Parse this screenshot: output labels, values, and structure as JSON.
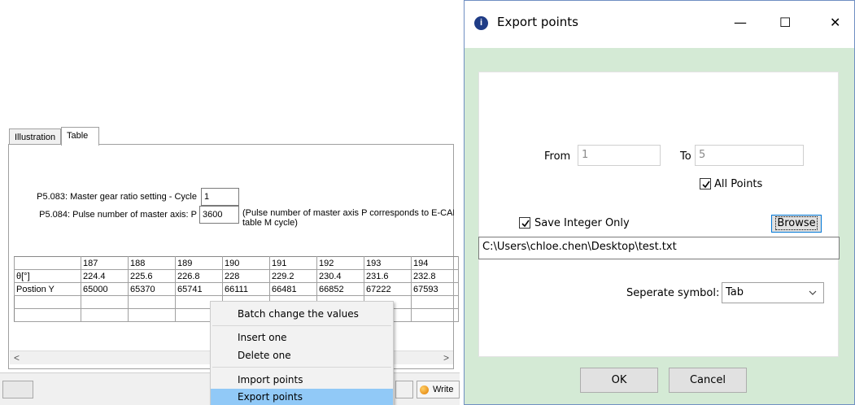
{
  "left": {
    "tabs": [
      {
        "label": "Illustration"
      },
      {
        "label": "Table"
      }
    ],
    "params": [
      {
        "label": "P5.083: Master gear ratio setting - Cycle",
        "value": "1"
      },
      {
        "label": "P5.084: Pulse number of master axis: P",
        "value": "3600",
        "note_line1": "(Pulse number of master axis P corresponds to E-CAM",
        "note_line2": "table M cycle)"
      }
    ],
    "table": {
      "columns": [
        "187",
        "188",
        "189",
        "190",
        "191",
        "192",
        "193",
        "194"
      ],
      "rows": [
        {
          "header": "θ[°]",
          "values": [
            "224.4",
            "225.6",
            "226.8",
            "228",
            "229.2",
            "230.4",
            "231.6",
            "232.8"
          ]
        },
        {
          "header": "Postion Y",
          "values": [
            "65000",
            "65370",
            "65741",
            "66111",
            "66481",
            "66852",
            "67222",
            "67593"
          ]
        }
      ]
    },
    "scroll_left": "<",
    "scroll_right": ">",
    "write_label": "Write"
  },
  "context_menu": {
    "items": [
      {
        "label": "Batch change the values"
      },
      {
        "label": "Insert one"
      },
      {
        "label": "Delete one"
      },
      {
        "label": "Import points"
      },
      {
        "label": "Export points"
      }
    ],
    "highlighted": "Export points"
  },
  "dialog": {
    "title": "Export points",
    "minimize": "—",
    "maximize": "☐",
    "close": "✕",
    "from_label": "From",
    "from_value": "1",
    "to_label": "To",
    "to_value": "5",
    "all_points_label": "All Points",
    "all_points_checked": true,
    "save_integer_label": "Save Integer Only",
    "save_integer_checked": true,
    "browse_label": "Browse",
    "path_value": "C:\\Users\\chloe.chen\\Desktop\\test.txt",
    "separate_label": "Seperate symbol:",
    "separate_value": "Tab",
    "ok_label": "OK",
    "cancel_label": "Cancel"
  },
  "colors": {
    "dialog_bg": "#d4ead5",
    "menu_highlight": "#91c9f7",
    "browse_focus": "#0078d7"
  }
}
